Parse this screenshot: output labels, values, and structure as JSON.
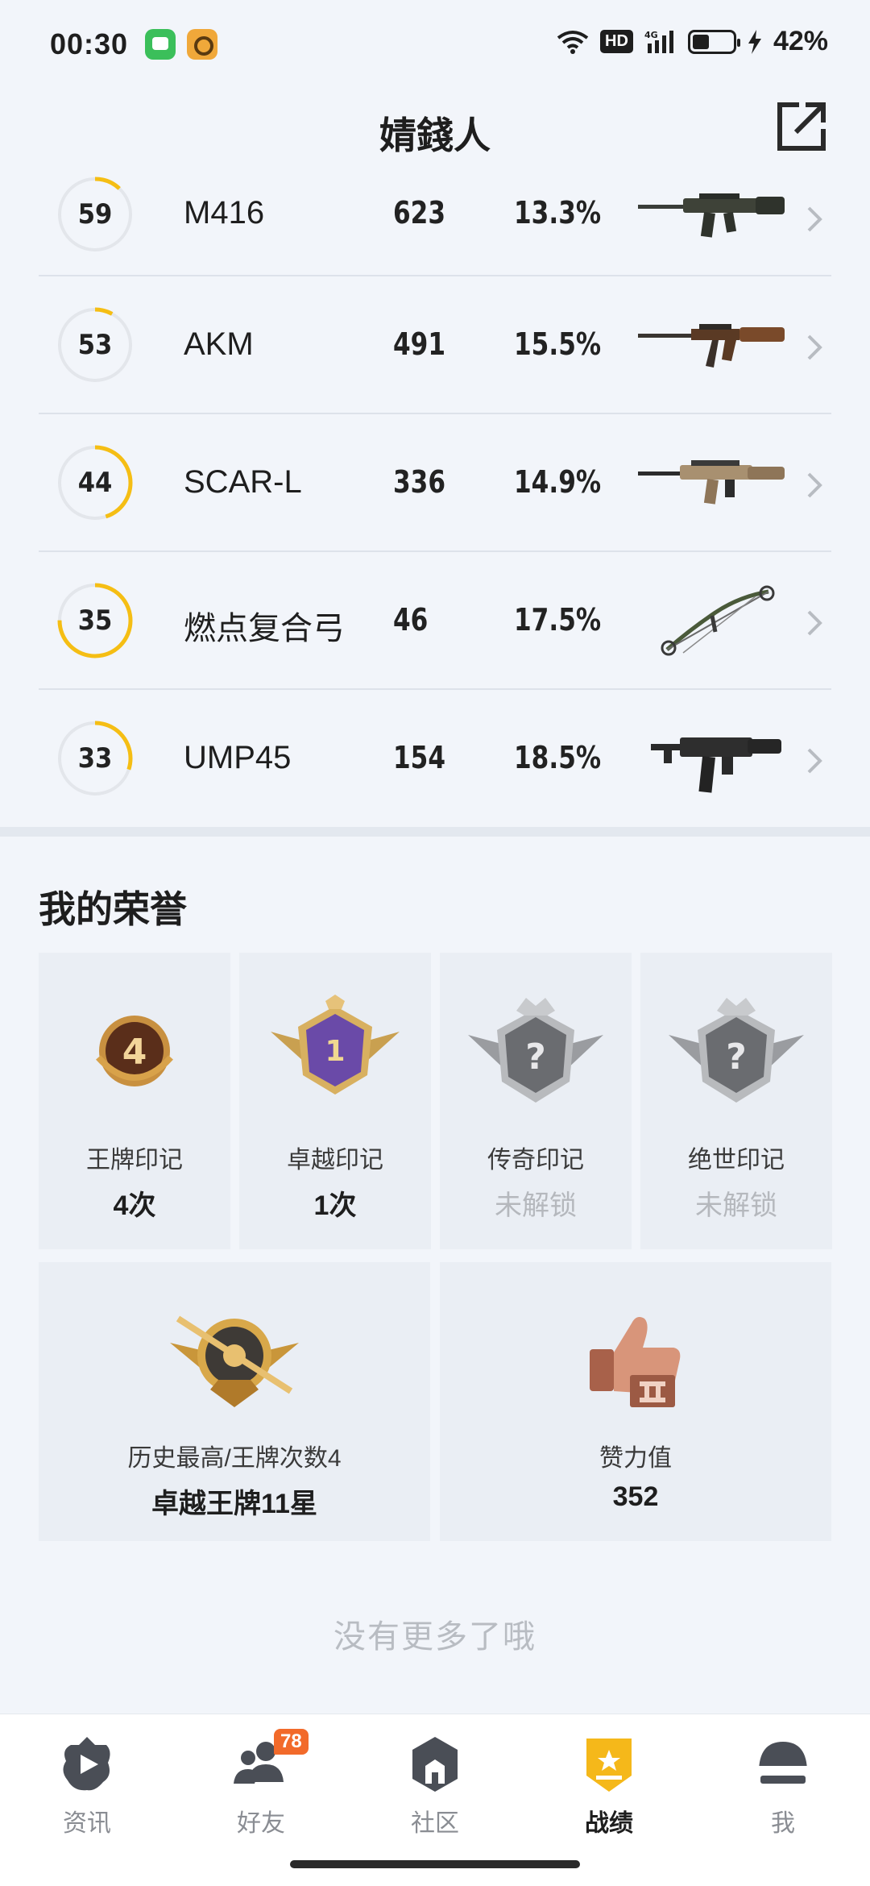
{
  "status_bar": {
    "time": "00:30",
    "battery_percent": "42%",
    "network": "4G",
    "hd_label": "HD"
  },
  "header": {
    "title": "婧錢人"
  },
  "weapons": [
    {
      "level": "59",
      "level_progress": 0.12,
      "name": "M416",
      "kills": "623",
      "rate": "13.3%",
      "icon": "rifle-m416-icon"
    },
    {
      "level": "53",
      "level_progress": 0.08,
      "name": "AKM",
      "kills": "491",
      "rate": "15.5%",
      "icon": "rifle-akm-icon"
    },
    {
      "level": "44",
      "level_progress": 0.45,
      "name": "SCAR-L",
      "kills": "336",
      "rate": "14.9%",
      "icon": "rifle-scarl-icon"
    },
    {
      "level": "35",
      "level_progress": 0.75,
      "name": "燃点复合弓",
      "kills": "46",
      "rate": "17.5%",
      "icon": "compound-bow-icon"
    },
    {
      "level": "33",
      "level_progress": 0.3,
      "name": "UMP45",
      "kills": "154",
      "rate": "18.5%",
      "icon": "smg-ump45-icon"
    }
  ],
  "honors": {
    "title": "我的荣誉",
    "cards": [
      {
        "label": "王牌印记",
        "value": "4次",
        "locked": false,
        "icon": "ace-badge-icon",
        "badge_text": "4"
      },
      {
        "label": "卓越印记",
        "value": "1次",
        "locked": false,
        "icon": "excellent-badge-icon",
        "badge_text": "1"
      },
      {
        "label": "传奇印记",
        "value": "未解锁",
        "locked": true,
        "icon": "legend-badge-icon",
        "badge_text": "?"
      },
      {
        "label": "绝世印记",
        "value": "未解锁",
        "locked": true,
        "icon": "peerless-badge-icon",
        "badge_text": "?"
      }
    ],
    "big_cards": [
      {
        "label": "历史最高/王牌次数4",
        "value": "卓越王牌11星",
        "icon": "rank-emblem-icon"
      },
      {
        "label": "赞力值",
        "value": "352",
        "icon": "thumbs-up-trophy-icon"
      }
    ]
  },
  "no_more_text": "没有更多了哦",
  "bottom_nav": {
    "items": [
      {
        "label": "资讯",
        "icon": "news-icon",
        "active": false
      },
      {
        "label": "好友",
        "icon": "friends-icon",
        "active": false,
        "badge": "78"
      },
      {
        "label": "社区",
        "icon": "community-icon",
        "active": false
      },
      {
        "label": "战绩",
        "icon": "record-icon",
        "active": true
      },
      {
        "label": "我",
        "icon": "helmet-icon",
        "active": false
      }
    ]
  },
  "colors": {
    "accent": "#f5be14",
    "background": "#f2f5fa",
    "card": "#eaeef4",
    "badge": "#f26a2a"
  }
}
